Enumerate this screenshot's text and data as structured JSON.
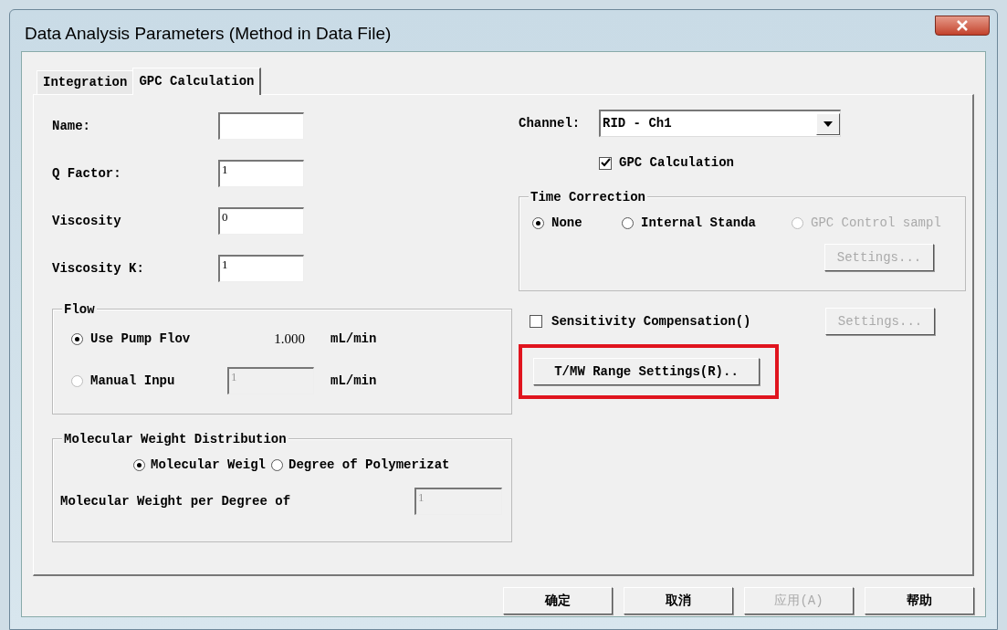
{
  "window": {
    "title": "Data Analysis Parameters (Method in Data File)"
  },
  "tabs": [
    {
      "label": "Integration",
      "selected": false
    },
    {
      "label": "GPC Calculation",
      "selected": true
    }
  ],
  "fields": [
    {
      "label": "Name:"
    },
    {
      "label": "Q Factor:",
      "value": "1"
    },
    {
      "label": "Viscosity",
      "value": "0"
    },
    {
      "label": "Viscosity K:",
      "value": "1"
    }
  ],
  "flow": {
    "title": "Flow",
    "options": [
      {
        "kind": "reading",
        "label": "Use Pump Flov",
        "selected": true,
        "value": "1.000",
        "unit": "mL/min"
      },
      {
        "kind": "input",
        "label": "Manual Inpu",
        "selected": false,
        "value": "1",
        "unit": "mL/min",
        "disabled": true
      }
    ]
  },
  "molecular_weight_distribution": {
    "title": "Molecular Weight Distribution",
    "options": [
      {
        "label": "Molecular Weigl",
        "selected": true
      },
      {
        "label": "Degree of Polymerizat",
        "selected": false
      }
    ],
    "per_degree": {
      "label": "Molecular Weight per Degree of",
      "value": "1",
      "disabled": true
    }
  },
  "channel": {
    "label": "Channel:",
    "value": "RID - Ch1"
  },
  "gpc_calculation": {
    "label": "GPC Calculation",
    "checked": true
  },
  "time_correction": {
    "title": "Time Correction",
    "options": [
      {
        "label": "None",
        "selected": true,
        "disabled": false
      },
      {
        "label": "Internal Standa",
        "selected": false,
        "disabled": false
      },
      {
        "label": "GPC Control sampl",
        "selected": false,
        "disabled": true
      }
    ],
    "settings": {
      "label": "Settings...",
      "disabled": true
    }
  },
  "sensitivity": {
    "label": "Sensitivity Compensation()",
    "checked": false,
    "settings": {
      "label": "Settings...",
      "disabled": true
    }
  },
  "range_button": {
    "label": "T/MW Range Settings(R)..",
    "highlighted": true
  },
  "buttons": [
    {
      "label": "确定",
      "disabled": false
    },
    {
      "label": "取消",
      "disabled": false
    },
    {
      "label": "应用(A)",
      "disabled": true
    },
    {
      "label": "帮助",
      "disabled": false
    }
  ]
}
